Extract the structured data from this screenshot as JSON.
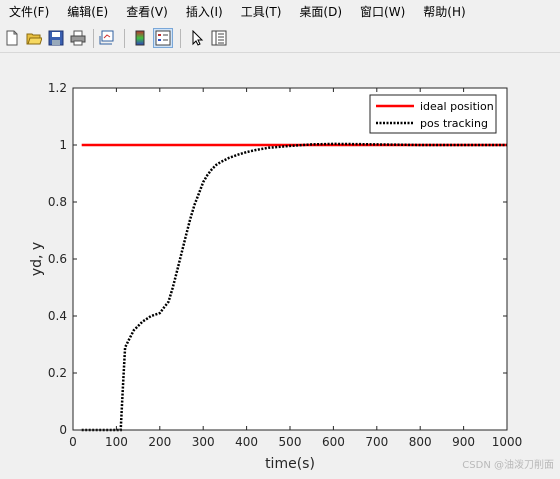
{
  "menubar": {
    "items": [
      "文件(F)",
      "编辑(E)",
      "查看(V)",
      "插入(I)",
      "工具(T)",
      "桌面(D)",
      "窗口(W)",
      "帮助(H)"
    ]
  },
  "toolbar": {
    "buttons": [
      {
        "name": "new-figure-icon"
      },
      {
        "name": "open-file-icon"
      },
      {
        "name": "save-icon"
      },
      {
        "name": "print-icon"
      },
      {
        "name": "link-plot-icon"
      },
      {
        "name": "insert-colorbar-icon"
      },
      {
        "name": "insert-legend-icon"
      },
      {
        "name": "edit-plot-cursor-icon"
      },
      {
        "name": "property-inspector-icon"
      }
    ]
  },
  "chart_data": {
    "type": "line",
    "xlabel": "time(s)",
    "ylabel": "yd, y",
    "xlim": [
      0,
      1000
    ],
    "ylim": [
      0,
      1.2
    ],
    "xticks": [
      "0",
      "100",
      "200",
      "300",
      "400",
      "500",
      "600",
      "700",
      "800",
      "900",
      "1000"
    ],
    "yticks": [
      "0",
      "0.2",
      "0.4",
      "0.6",
      "0.8",
      "1",
      "1.2"
    ],
    "grid": false,
    "legend_position": "top-right",
    "colors": {
      "ideal": "#ff0000",
      "tracking": "#000000"
    },
    "series": [
      {
        "name": "ideal position",
        "style": "solid",
        "x": [
          20,
          1000
        ],
        "y": [
          1,
          1
        ]
      },
      {
        "name": "pos tracking",
        "style": "dotted",
        "x": [
          20,
          100,
          105,
          110,
          115,
          120,
          130,
          140,
          160,
          180,
          200,
          210,
          220,
          230,
          240,
          250,
          260,
          270,
          280,
          290,
          300,
          310,
          320,
          330,
          340,
          360,
          380,
          400,
          420,
          450,
          500,
          550,
          600,
          650,
          700,
          800,
          900,
          1000
        ],
        "y": [
          0,
          0,
          0,
          0.0,
          0.15,
          0.29,
          0.32,
          0.35,
          0.38,
          0.4,
          0.41,
          0.43,
          0.45,
          0.5,
          0.56,
          0.62,
          0.68,
          0.74,
          0.79,
          0.83,
          0.87,
          0.895,
          0.915,
          0.93,
          0.94,
          0.955,
          0.966,
          0.975,
          0.982,
          0.99,
          0.997,
          1.002,
          1.004,
          1.003,
          1.002,
          1.0,
          1.0,
          1.0
        ]
      }
    ]
  },
  "watermark": "CSDN @油泼刀削面"
}
